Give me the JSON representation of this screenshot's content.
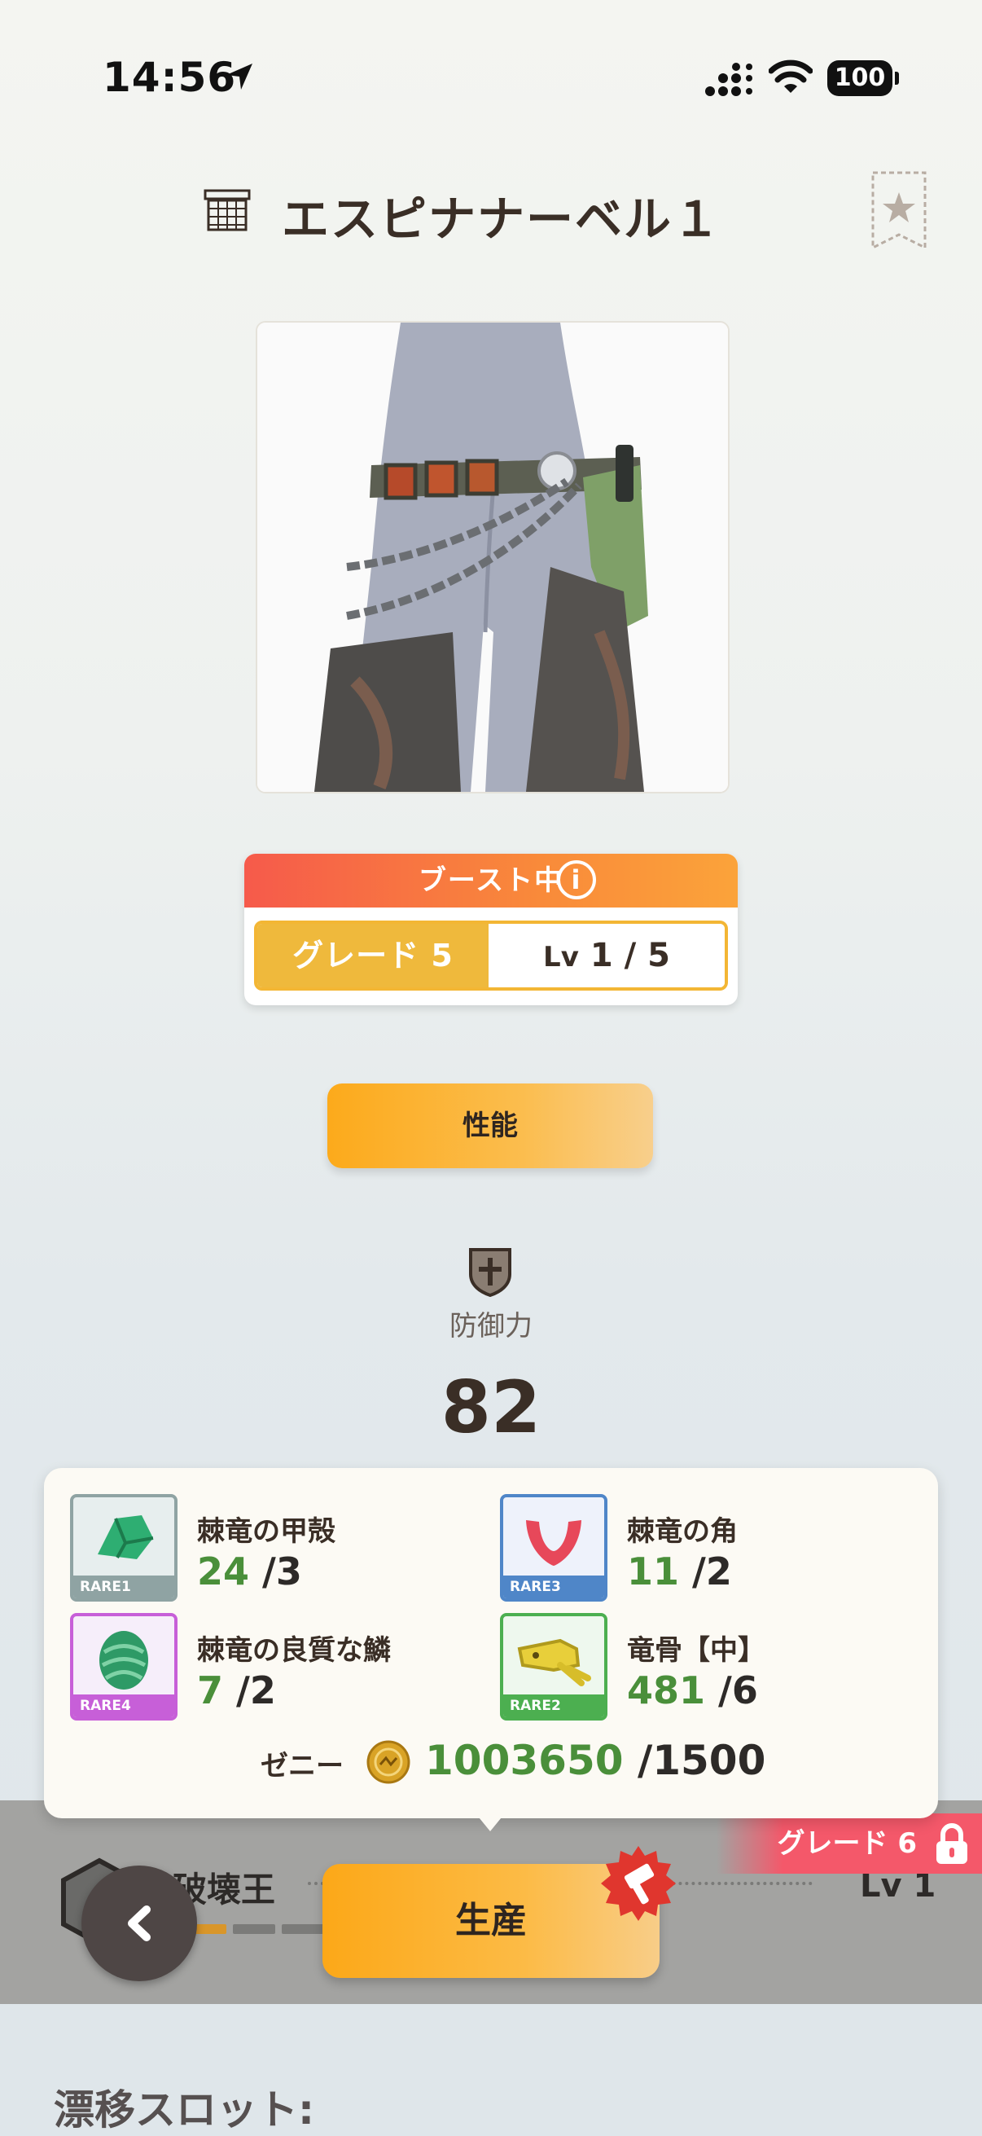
{
  "status_bar": {
    "time": "14:56",
    "battery": "100"
  },
  "header": {
    "title": "エスピナナーベル１"
  },
  "boost": {
    "label": "ブースト中",
    "grade": "グレード 5",
    "lv_prefix": "Lv",
    "lv_value": "1 / 5"
  },
  "tabs": {
    "performance": "性能"
  },
  "stats": {
    "defense_label": "防御力",
    "defense_value": "82"
  },
  "materials": [
    {
      "name": "棘竜の甲殻",
      "have": "24",
      "need": " /3",
      "rarity": "RARE1",
      "rarity_color": "#8fa3a3"
    },
    {
      "name": "棘竜の角",
      "have": "11",
      "need": " /2",
      "rarity": "RARE3",
      "rarity_color": "#4f86c8"
    },
    {
      "name": "棘竜の良質な鱗",
      "have": "7",
      "need": " /2",
      "rarity": "RARE4",
      "rarity_color": "#c75fd8"
    },
    {
      "name": "竜骨【中】",
      "have": "481",
      "need": " /6",
      "rarity": "RARE2",
      "rarity_color": "#4caf50"
    }
  ],
  "zeny": {
    "label": "ゼニー",
    "have": "1003650",
    "need": " /1500"
  },
  "skill": {
    "name": "破壊王",
    "level": "Lv 1"
  },
  "next_grade": {
    "label": "グレード 6"
  },
  "actions": {
    "produce": "生産"
  },
  "section": {
    "drift_slot": "漂移スロット:"
  },
  "colors": {
    "accent_orange": "#fcaa1b",
    "boost_red": "#f65a4b",
    "have_green": "#4a8f3a"
  }
}
